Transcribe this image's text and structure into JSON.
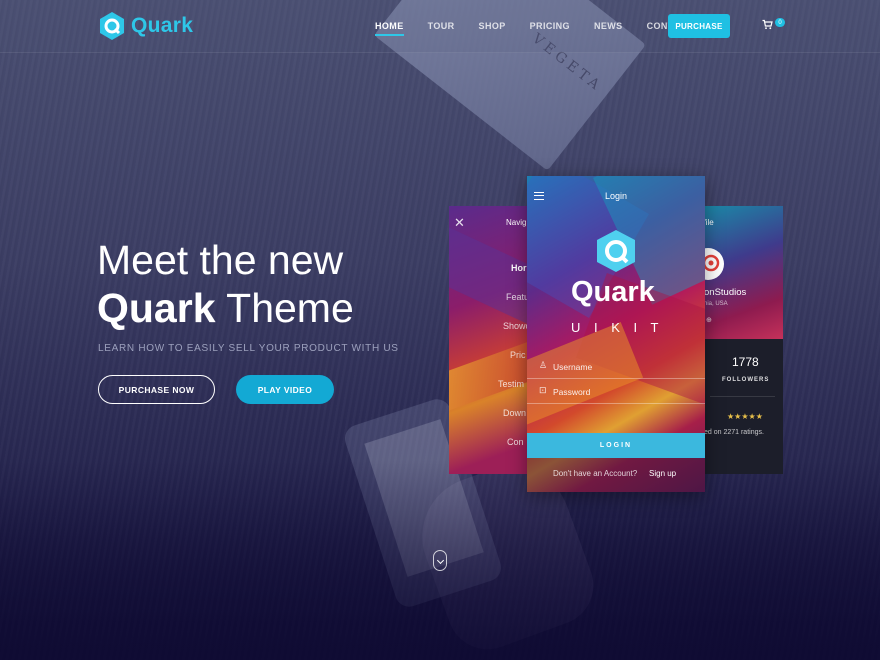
{
  "brand": {
    "name": "Quark",
    "accent": "#1fc0e3"
  },
  "nav": {
    "items": [
      "HOME",
      "TOUR",
      "SHOP",
      "PRICING",
      "NEWS",
      "CONTACT"
    ],
    "active": "HOME",
    "purchase_label": "PURCHASE",
    "cart_count": "0"
  },
  "hero": {
    "title_line1": "Meet the new",
    "title_bold": "Quark",
    "title_rest": "Theme",
    "subtitle": "LEARN HOW TO EASILY SELL YOUR PRODUCT WITH US",
    "primary_label": "PURCHASE NOW",
    "secondary_label": "PLAY VIDEO"
  },
  "left_card": {
    "header": "Navig",
    "items": [
      "Hor",
      "Featu",
      "Showc",
      "Pric",
      "Testim",
      "Down",
      "Con"
    ]
  },
  "login_card": {
    "header": "Login",
    "logo_text": "Quark",
    "kit_text": "U I K I T",
    "username_placeholder": "Username",
    "password_placeholder": "Password",
    "login_label": "LOGIN",
    "footer_text": "Don't have an Account?",
    "signup_label": "Sign up"
  },
  "right_card": {
    "header": "ofile",
    "name": "onStudios",
    "location": "nia, USA",
    "followers_count": "1778",
    "followers_label": "FOLLOWERS",
    "rating_text": "ed on 2271 ratings."
  }
}
